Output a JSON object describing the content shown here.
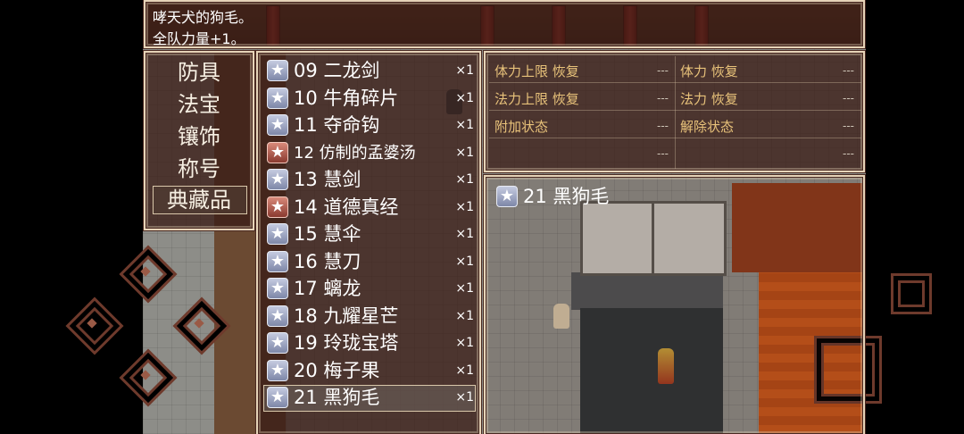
{
  "message": {
    "line1": "哮天犬的狗毛。",
    "line2": "全队力量+1。"
  },
  "categories": [
    "防具",
    "法宝",
    "镶饰",
    "称号",
    "典藏品"
  ],
  "selected_category": "典藏品",
  "items": [
    {
      "name": "09 二龙剑",
      "qty": "×1",
      "icon": "star-icon",
      "color": "silver"
    },
    {
      "name": "10 牛角碎片",
      "qty": "×1",
      "icon": "star-icon",
      "color": "silver"
    },
    {
      "name": "11 夺命钩",
      "qty": "×1",
      "icon": "star-icon",
      "color": "silver"
    },
    {
      "name": "12 仿制的孟婆汤",
      "qty": "×1",
      "icon": "star-icon",
      "color": "red"
    },
    {
      "name": "13 慧剑",
      "qty": "×1",
      "icon": "star-icon",
      "color": "silver"
    },
    {
      "name": "14 道德真经",
      "qty": "×1",
      "icon": "star-icon",
      "color": "red"
    },
    {
      "name": "15 慧伞",
      "qty": "×1",
      "icon": "star-icon",
      "color": "silver"
    },
    {
      "name": "16 慧刀",
      "qty": "×1",
      "icon": "star-icon",
      "color": "silver"
    },
    {
      "name": "17 螭龙",
      "qty": "×1",
      "icon": "star-icon",
      "color": "silver"
    },
    {
      "name": "18 九耀星芒",
      "qty": "×1",
      "icon": "star-icon",
      "color": "silver"
    },
    {
      "name": "19 玲珑宝塔",
      "qty": "×1",
      "icon": "star-icon",
      "color": "silver"
    },
    {
      "name": "20 梅子果",
      "qty": "×1",
      "icon": "star-icon",
      "color": "silver"
    },
    {
      "name": "21 黑狗毛",
      "qty": "×1",
      "icon": "star-icon",
      "color": "silver"
    }
  ],
  "selected_item": "21 黑狗毛",
  "stats": {
    "hp_max_restore": "体力上限 恢复",
    "hp_restore": "体力 恢复",
    "mp_max_restore": "法力上限 恢复",
    "mp_restore": "法力 恢复",
    "add_status": "附加状态",
    "remove_status": "解除状态",
    "dash": "---"
  },
  "detail": {
    "name": "21 黑狗毛",
    "icon": "star-icon"
  },
  "colors": {
    "window_bg": "#3a1c16",
    "border": "#e6d4b8",
    "stat_label": "#e8c27a",
    "star_silver": "#9aa2c0",
    "star_red": "#b05a4c"
  }
}
